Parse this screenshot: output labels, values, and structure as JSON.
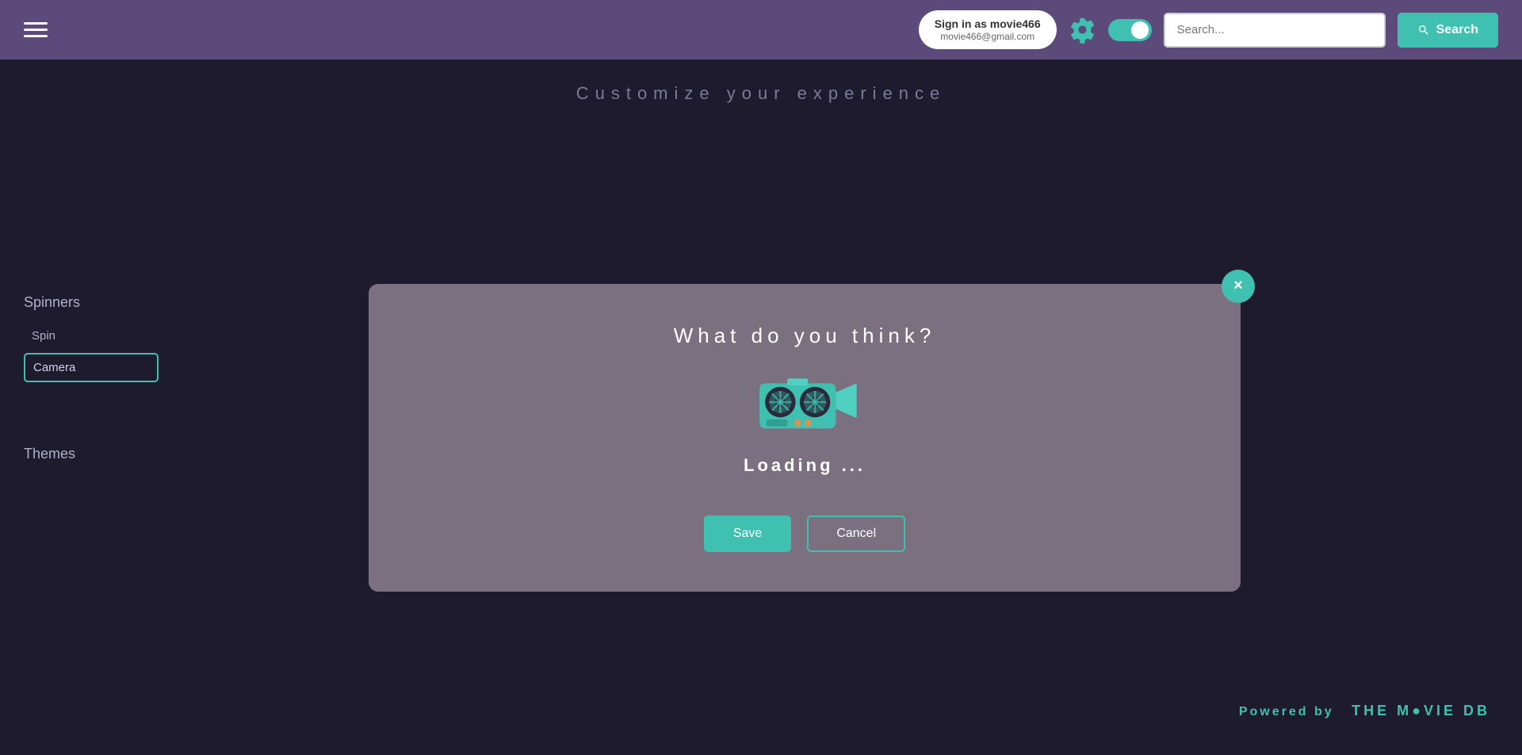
{
  "header": {
    "hamburger_label": "menu",
    "sign_in_label": "Sign in as movie466",
    "email": "movie466@gmail.com",
    "gear_label": "settings",
    "toggle_state": true,
    "search_placeholder": "Search...",
    "search_button_label": "Search"
  },
  "page": {
    "title": "Customize your experience"
  },
  "sidebar": {
    "spinners_title": "Spinners",
    "spin_label": "Spin",
    "camera_label": "Camera",
    "themes_title": "Themes"
  },
  "modal": {
    "title": "What do you think?",
    "loading_text": "Loading ...",
    "save_label": "Save",
    "cancel_label": "Cancel",
    "close_label": "×"
  },
  "footer": {
    "powered_by": "Powered by",
    "db_name": "THE M●VIE DB"
  }
}
